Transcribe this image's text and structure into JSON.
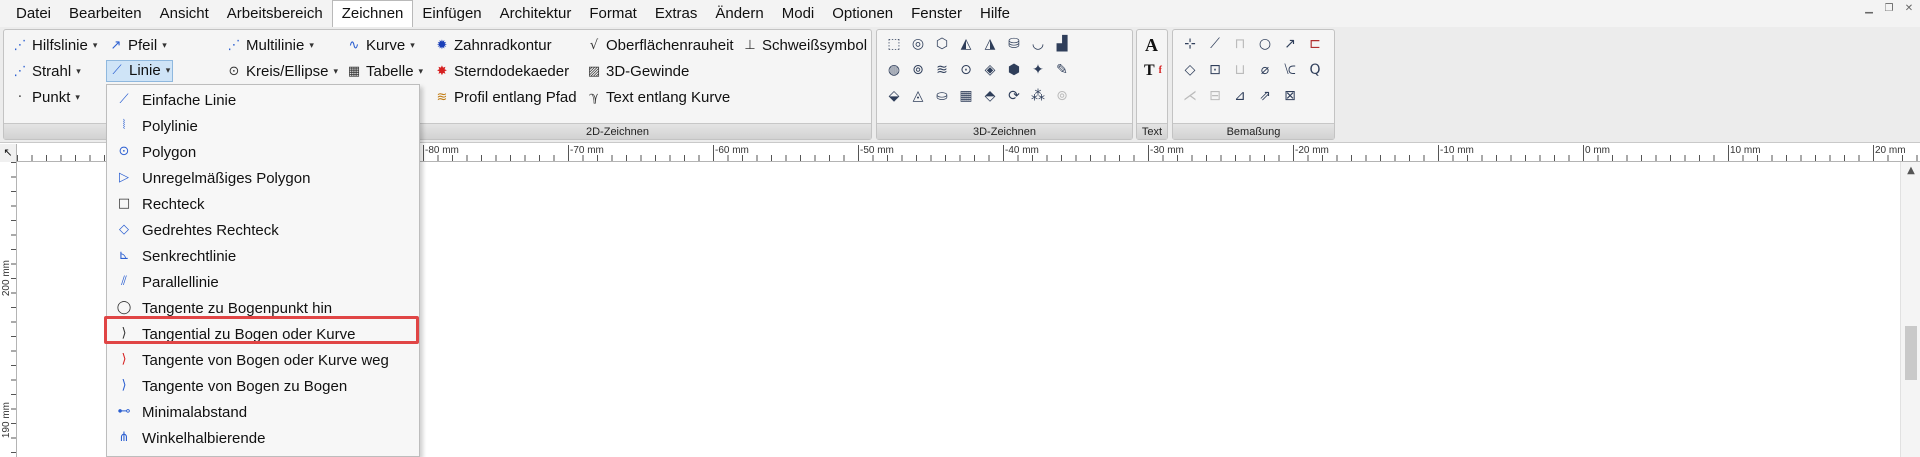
{
  "menubar": {
    "items": [
      "Datei",
      "Bearbeiten",
      "Ansicht",
      "Arbeitsbereich",
      "Zeichnen",
      "Einfügen",
      "Architektur",
      "Format",
      "Extras",
      "Ändern",
      "Modi",
      "Optionen",
      "Fenster",
      "Hilfe"
    ],
    "active": "Zeichnen",
    "window_controls": [
      "▁",
      "❐",
      "✕"
    ]
  },
  "ribbon": {
    "draw2d": {
      "label": "2D-Zeichnen",
      "col1": [
        "Hilfslinie",
        "Strahl",
        "Punkt"
      ],
      "col2": [
        "Pfeil",
        "Linie"
      ],
      "col3": [
        "Multilinie",
        "Kreis/Ellipse"
      ],
      "col4": [
        "Kurve",
        "Tabelle"
      ],
      "col5": [
        "Zahnradkontur",
        "Sterndodekaeder",
        "Profil entlang Pfad"
      ],
      "col6": [
        "Oberflächenrauheit",
        "3D-Gewinde",
        "Text entlang Kurve"
      ],
      "col7": [
        "Schweißsymbol"
      ]
    },
    "draw3d": {
      "label": "3D-Zeichnen"
    },
    "text": {
      "label": "Text",
      "icons": [
        "A",
        "T"
      ]
    },
    "dim": {
      "label": "Bemaßung"
    }
  },
  "ruler": {
    "corner": "↖",
    "h_labels": [
      "-80 mm",
      "-70 mm",
      "-60 mm",
      "-50 mm",
      "-40 mm",
      "-30 mm",
      "-20 mm",
      "-10 mm",
      "0 mm",
      "10 mm",
      "20 mm"
    ],
    "v_labels": [
      "200 mm",
      "190 mm"
    ]
  },
  "dropdown": {
    "items": [
      {
        "label": "Einfache Linie",
        "icon": "line-icon"
      },
      {
        "label": "Polylinie",
        "icon": "polyline-icon"
      },
      {
        "label": "Polygon",
        "icon": "polygon-icon"
      },
      {
        "label": "Unregelmäßiges Polygon",
        "icon": "irregular-polygon-icon"
      },
      {
        "label": "Rechteck",
        "icon": "rectangle-icon"
      },
      {
        "label": "Gedrehtes Rechteck",
        "icon": "rotated-rectangle-icon"
      },
      {
        "label": "Senkrechtlinie",
        "icon": "perpendicular-line-icon"
      },
      {
        "label": "Parallellinie",
        "icon": "parallel-line-icon"
      },
      {
        "label": "Tangente zu Bogenpunkt hin",
        "icon": "tangent-to-arc-point-icon"
      },
      {
        "label": "Tangential zu Bogen oder Kurve",
        "icon": "tangential-arc-curve-icon"
      },
      {
        "label": "Tangente von Bogen oder Kurve weg",
        "icon": "tangent-from-arc-icon"
      },
      {
        "label": "Tangente von Bogen zu Bogen",
        "icon": "tangent-arc-to-arc-icon"
      },
      {
        "label": "Minimalabstand",
        "icon": "minimal-distance-icon"
      },
      {
        "label": "Winkelhalbierende",
        "icon": "angle-bisector-icon"
      }
    ],
    "highlighted": "Tangential zu Bogen oder Kurve"
  },
  "colors": {
    "accent_blue": "#2b5fd1",
    "highlight_red": "#e04545",
    "selected_bg": "#cfe4f7"
  }
}
